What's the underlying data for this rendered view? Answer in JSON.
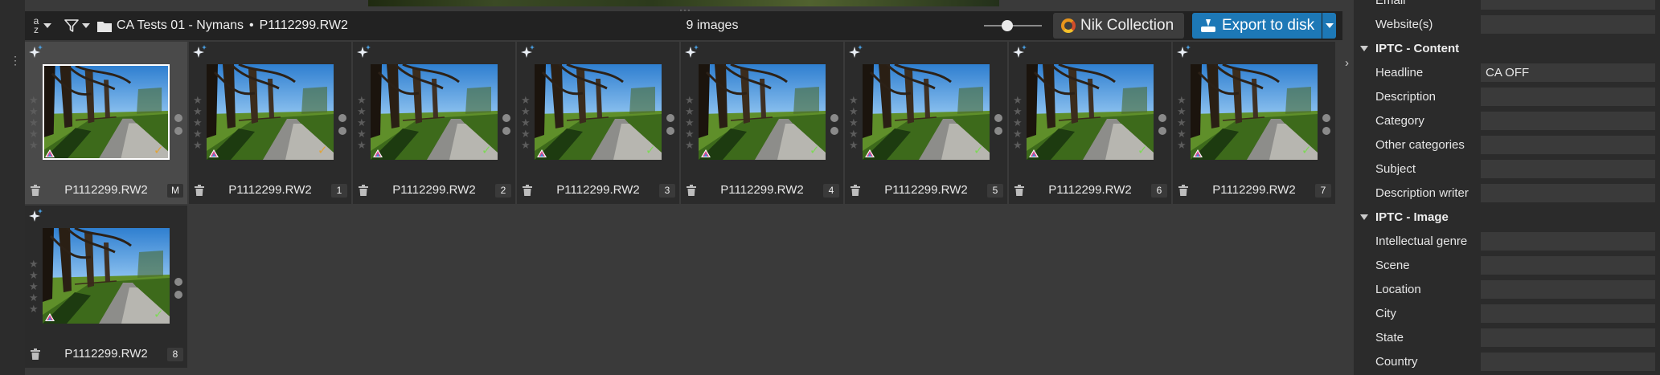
{
  "toolbar": {
    "breadcrumb": {
      "folder": "CA Tests 01 - Nymans",
      "separator": "•",
      "file": "P1112299.RW2"
    },
    "image_count": "9 images",
    "nik_label": "Nik Collection",
    "export_label": "Export to disk",
    "sort_label": "a z"
  },
  "thumbnails": [
    {
      "filename": "P1112299.RW2",
      "badge": "M",
      "selected": true,
      "status": "pending"
    },
    {
      "filename": "P1112299.RW2",
      "badge": "1",
      "selected": false,
      "status": "pending"
    },
    {
      "filename": "P1112299.RW2",
      "badge": "2",
      "selected": false,
      "status": "done"
    },
    {
      "filename": "P1112299.RW2",
      "badge": "3",
      "selected": false,
      "status": "done"
    },
    {
      "filename": "P1112299.RW2",
      "badge": "4",
      "selected": false,
      "status": "done"
    },
    {
      "filename": "P1112299.RW2",
      "badge": "5",
      "selected": false,
      "status": "done"
    },
    {
      "filename": "P1112299.RW2",
      "badge": "6",
      "selected": false,
      "status": "done"
    },
    {
      "filename": "P1112299.RW2",
      "badge": "7",
      "selected": false,
      "status": "done"
    },
    {
      "filename": "P1112299.RW2",
      "badge": "8",
      "selected": false,
      "status": "done"
    }
  ],
  "metadata": {
    "rows": [
      {
        "kind": "field",
        "label": "Email",
        "value": ""
      },
      {
        "kind": "field",
        "label": "Website(s)",
        "value": ""
      },
      {
        "kind": "section",
        "label": "IPTC - Content"
      },
      {
        "kind": "field",
        "label": "Headline",
        "value": "CA OFF"
      },
      {
        "kind": "field",
        "label": "Description",
        "value": ""
      },
      {
        "kind": "field",
        "label": "Category",
        "value": ""
      },
      {
        "kind": "field",
        "label": "Other categories",
        "value": ""
      },
      {
        "kind": "field",
        "label": "Subject",
        "value": ""
      },
      {
        "kind": "field",
        "label": "Description writer",
        "value": ""
      },
      {
        "kind": "section",
        "label": "IPTC - Image"
      },
      {
        "kind": "field",
        "label": "Intellectual genre",
        "value": ""
      },
      {
        "kind": "field",
        "label": "Scene",
        "value": ""
      },
      {
        "kind": "field",
        "label": "Location",
        "value": ""
      },
      {
        "kind": "field",
        "label": "City",
        "value": ""
      },
      {
        "kind": "field",
        "label": "State",
        "value": ""
      },
      {
        "kind": "field",
        "label": "Country",
        "value": ""
      }
    ]
  },
  "colors": {
    "accent": "#1d78b6",
    "check_done": "#7ed957",
    "check_pending": "#e0a43a",
    "background": "#3a3a3a",
    "panel": "#2b2b2b",
    "toolbar": "#222222"
  }
}
